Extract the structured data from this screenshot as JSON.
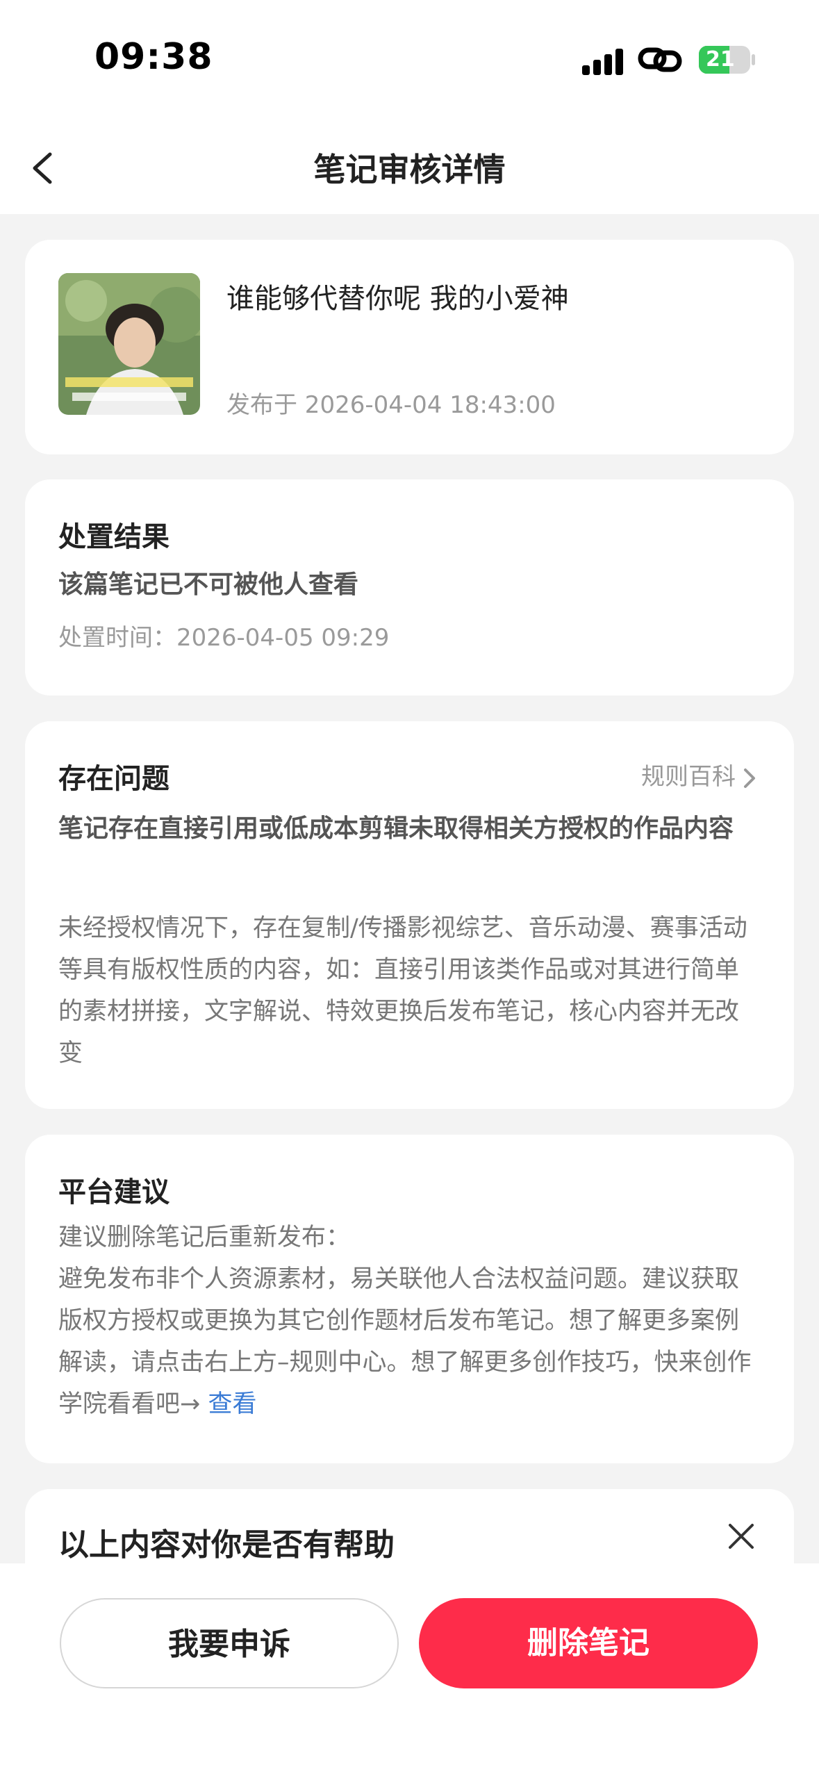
{
  "status_bar": {
    "time": "09:38",
    "battery": "21"
  },
  "nav": {
    "title": "笔记审核详情"
  },
  "note": {
    "title": "谁能够代替你呢 我的小爱神",
    "date": "发布于 2026-04-04 18:43:00"
  },
  "result": {
    "title": "处置结果",
    "text": "该篇笔记已不可被他人查看",
    "time": "处置时间：2026-04-05 09:29"
  },
  "issue": {
    "title": "存在问题",
    "rule_link": "规则百科",
    "headline": "笔记存在直接引用或低成本剪辑未取得相关方授权的作品内容",
    "desc": "未经授权情况下，存在复制/传播影视综艺、音乐动漫、赛事活动等具有版权性质的内容，如：直接引用该类作品或对其进行简单的素材拼接，文字解说、特效更换后发布笔记，核心内容并无改变"
  },
  "advice": {
    "title": "平台建议",
    "line1": "建议删除笔记后重新发布：",
    "body": "避免发布非个人资源素材，易关联他人合法权益问题。建议获取版权方授权或更换为其它创作题材后发布笔记。想了解更多案例解读，请点击右上方–规则中心。想了解更多创作技巧，快来创作学院看看吧→ ",
    "link": "查看"
  },
  "feedback": {
    "title": "以上内容对你是否有帮助"
  },
  "buttons": {
    "appeal": "我要申诉",
    "delete": "删除笔记"
  },
  "colors": {
    "accent": "#fe2c4a",
    "link": "#3a7bd5",
    "battery": "#35c759"
  },
  "icons": [
    "signal-icon",
    "link-icon",
    "battery-icon",
    "back-icon",
    "chevron-right-icon",
    "close-icon"
  ]
}
